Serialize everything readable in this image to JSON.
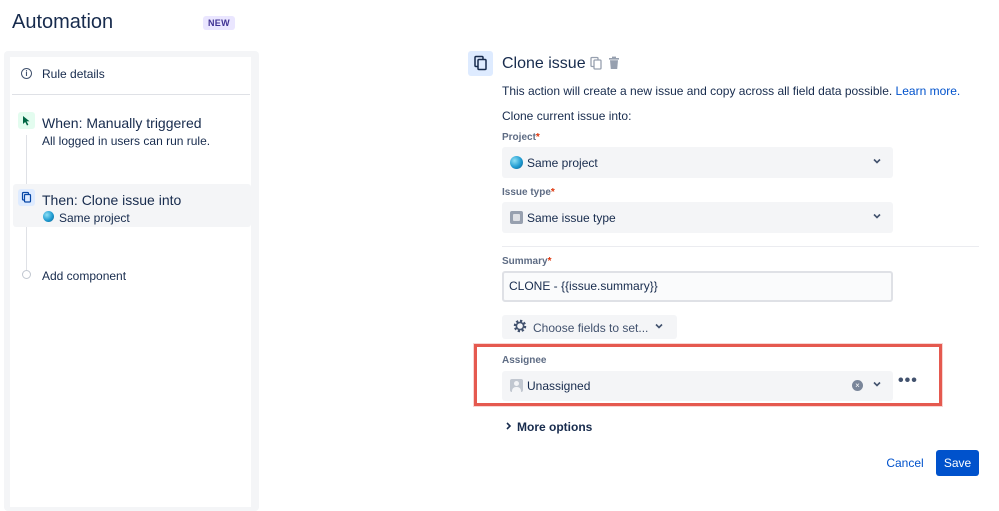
{
  "app": {
    "title": "Automation",
    "badge": "NEW"
  },
  "sidebar": {
    "rule_details": "Rule details",
    "trigger": {
      "title": "When: Manually triggered",
      "subtitle": "All logged in users can run rule."
    },
    "action": {
      "title": "Then: Clone issue into",
      "subtitle": "Same project"
    },
    "add_component": "Add component"
  },
  "panel": {
    "title": "Clone issue",
    "description": "This action will create a new issue and copy across all field data possible.",
    "learn_more": "Learn more.",
    "clone_into": "Clone current issue into:",
    "project": {
      "label": "Project",
      "required": "*",
      "value": "Same project"
    },
    "issue_type": {
      "label": "Issue type",
      "required": "*",
      "value": "Same issue type"
    },
    "summary": {
      "label": "Summary",
      "required": "*",
      "value": "CLONE - {{issue.summary}}"
    },
    "choose_fields": "Choose fields to set...",
    "assignee": {
      "label": "Assignee",
      "value": "Unassigned"
    },
    "more_options": "More options",
    "cancel": "Cancel",
    "save": "Save"
  },
  "icons": {
    "info": "info-icon",
    "trigger": "cursor-icon",
    "action": "copy-icon",
    "trash": "trash-icon",
    "gear": "gear-icon",
    "chevron": "chevron-down-icon",
    "clear": "clear-icon",
    "more": "more-icon"
  },
  "colors": {
    "accent": "#0052cc",
    "highlight": "#e5594f",
    "required": "#de350b",
    "badge_bg": "#eae6ff",
    "badge_text": "#403294"
  }
}
